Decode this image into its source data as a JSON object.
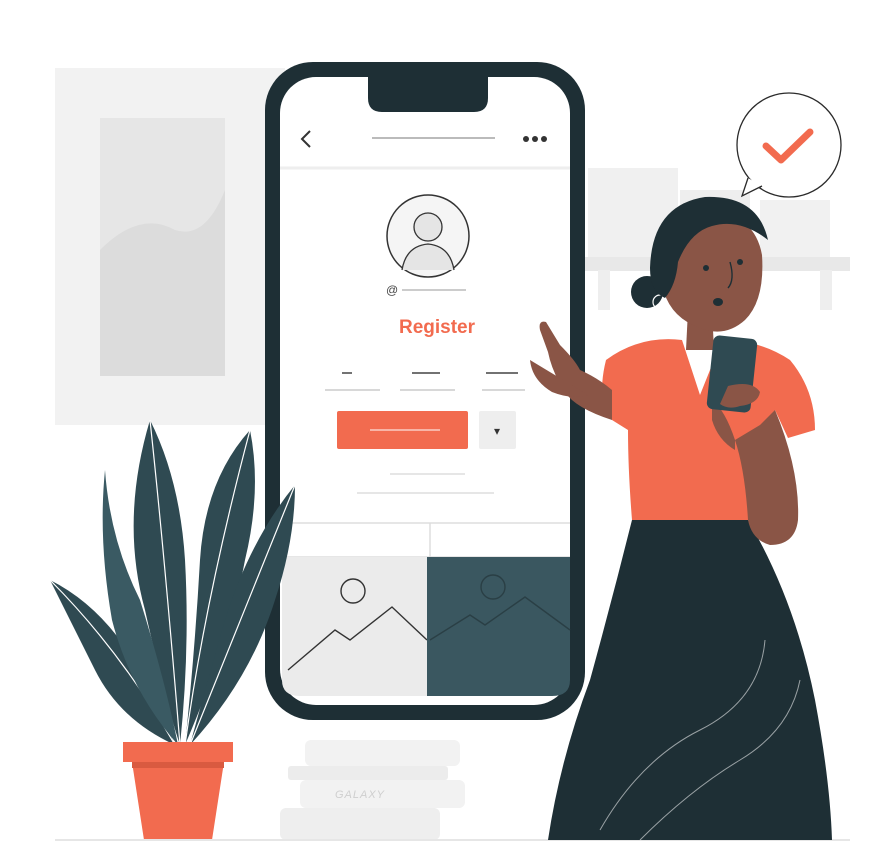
{
  "phone": {
    "title": "Register",
    "at_symbol": "@",
    "dropdown_arrow": "▾",
    "back_arrow": "<",
    "menu_dots": "•••"
  },
  "books": {
    "spine_text": "GALAXY"
  },
  "speech_bubble": {
    "icon": "checkmark-icon"
  },
  "colors": {
    "accent": "#F26B4F",
    "dark": "#1E2F35",
    "teal": "#3A5760",
    "skin": "#8A5546",
    "light_gray": "#EBEBEB"
  }
}
